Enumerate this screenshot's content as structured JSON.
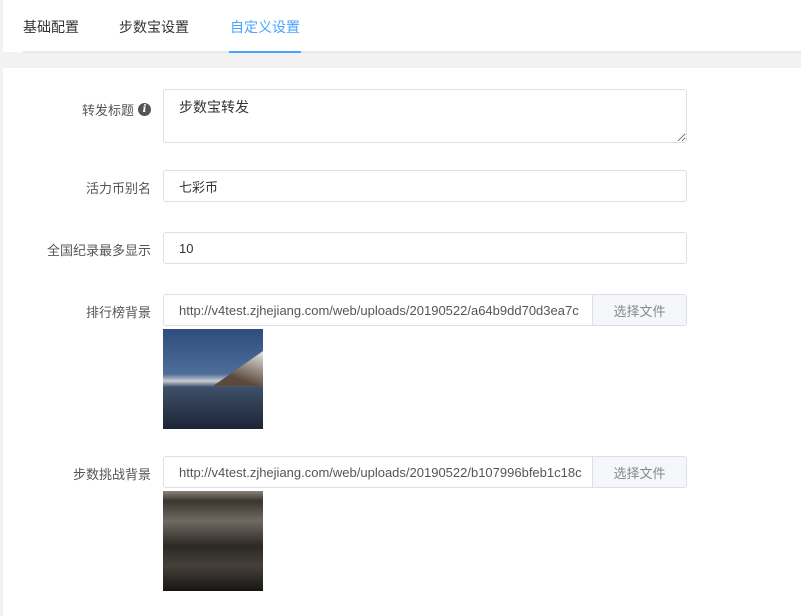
{
  "tabs": [
    {
      "label": "基础配置"
    },
    {
      "label": "步数宝设置"
    },
    {
      "label": "自定义设置",
      "active": true
    }
  ],
  "form": {
    "share_title": {
      "label": "转发标题",
      "info_icon": "info-icon",
      "value": "步数宝转发"
    },
    "coin_alias": {
      "label": "活力币别名",
      "value": "七彩币"
    },
    "max_records": {
      "label": "全国纪录最多显示",
      "value": "10"
    },
    "rank_bg": {
      "label": "排行榜背景",
      "value": "http://v4test.zjhejiang.com/web/uploads/20190522/a64b9dd70d3ea7c",
      "button": "选择文件"
    },
    "challenge_bg": {
      "label": "步数挑战背景",
      "value": "http://v4test.zjhejiang.com/web/uploads/20190522/b107996bfeb1c18c",
      "button": "选择文件"
    }
  }
}
